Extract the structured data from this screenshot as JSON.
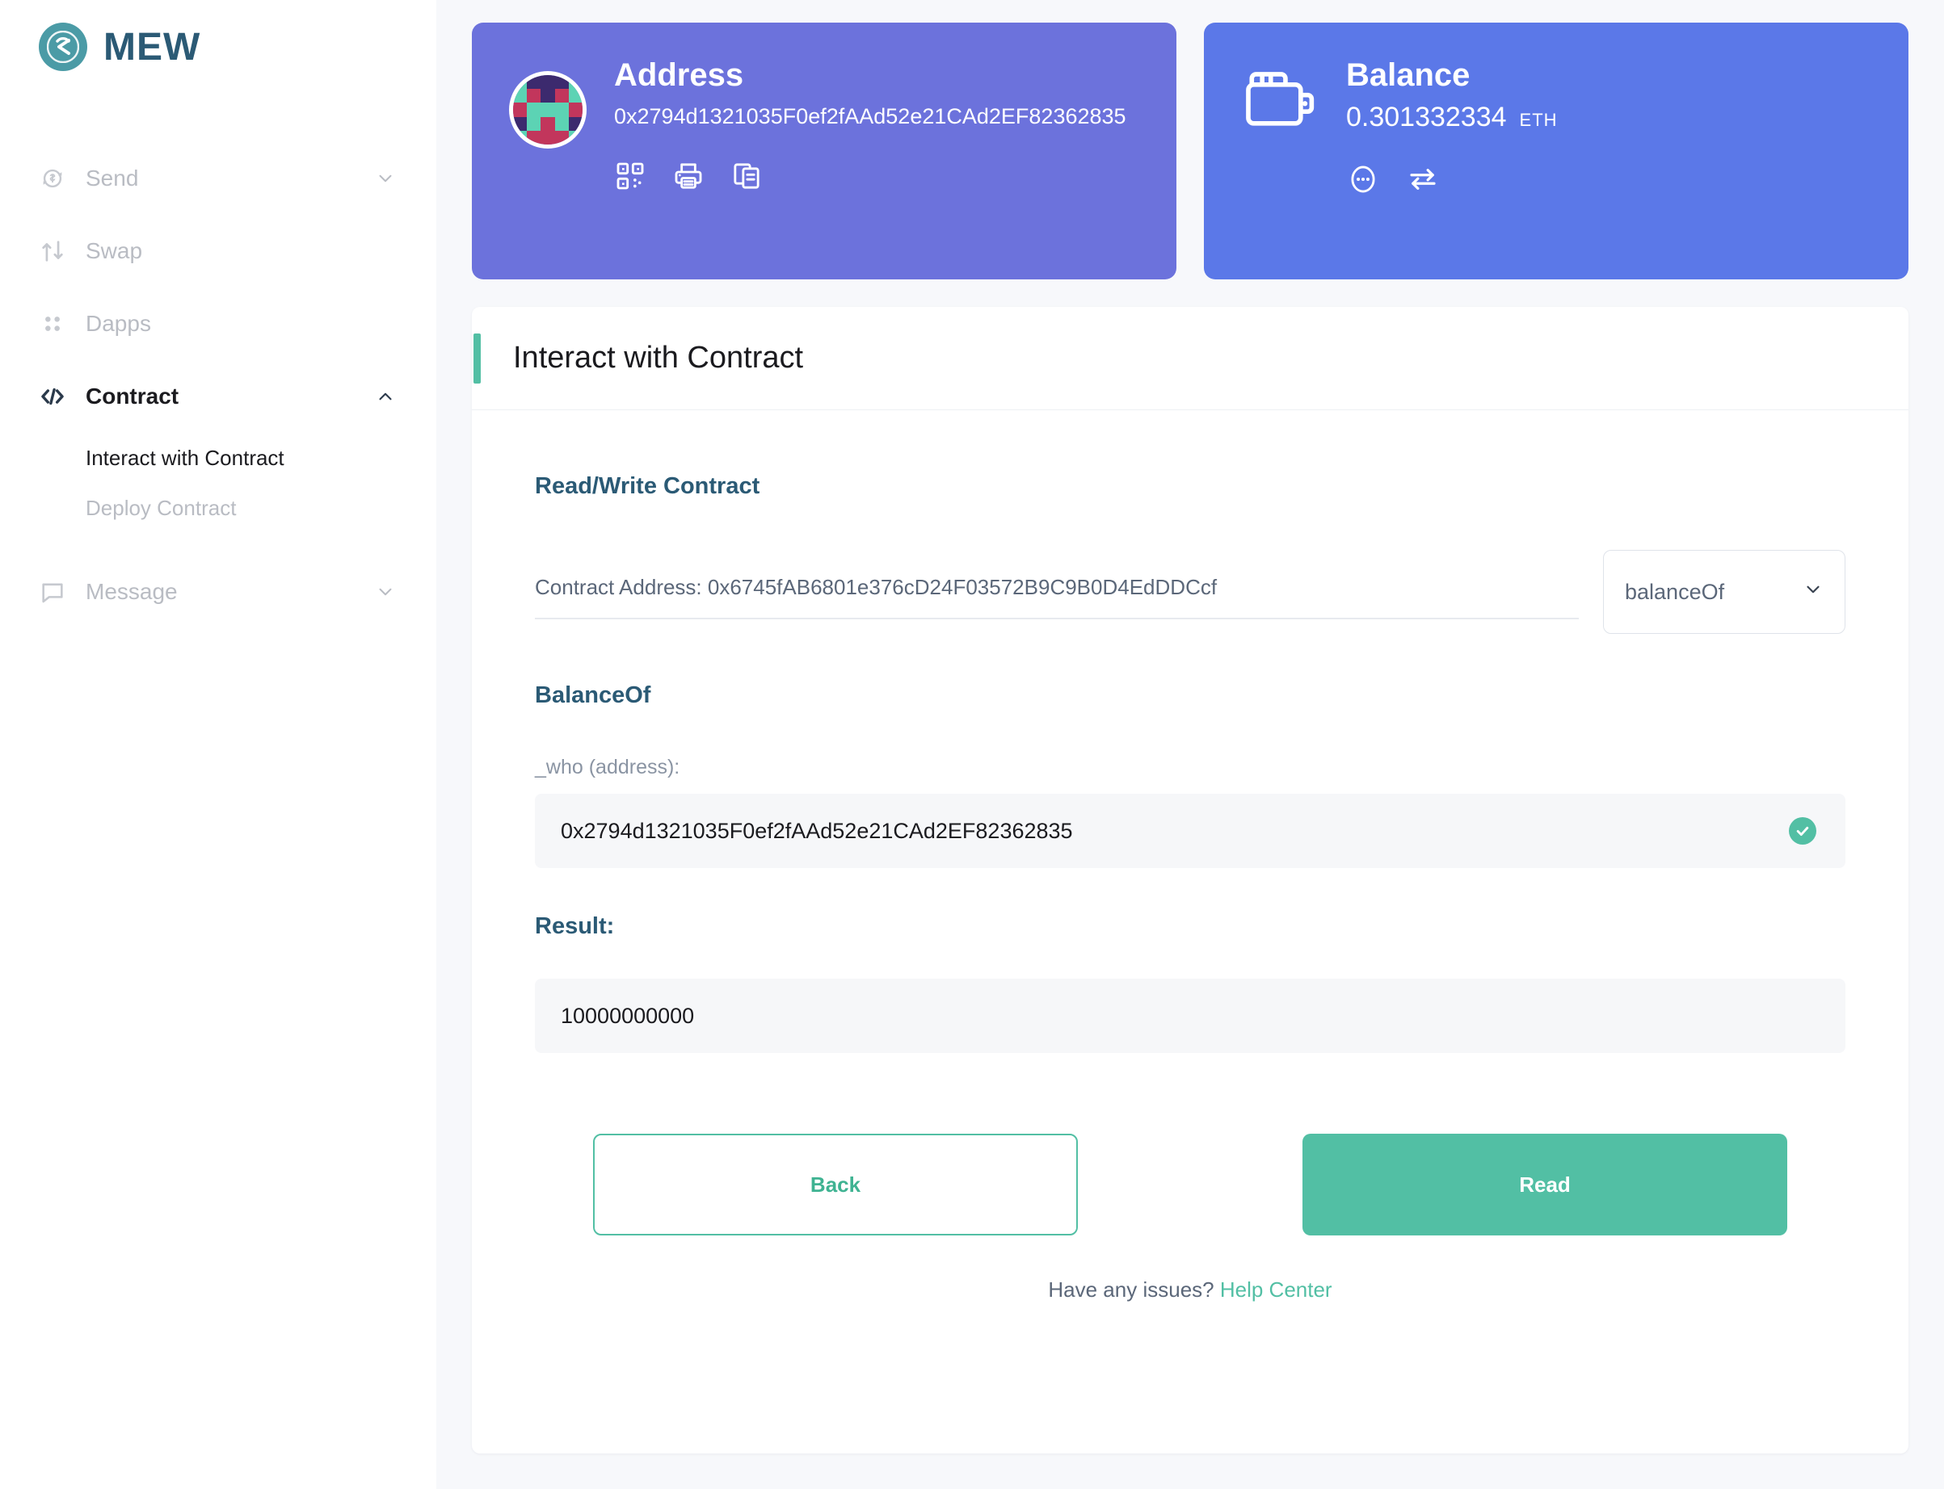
{
  "brand": {
    "name": "MEW",
    "logo_icon": "mew-logo-icon"
  },
  "sidebar": {
    "items": [
      {
        "label": "Send",
        "icon": "send-circle-icon",
        "chevron": "chevron-down-icon",
        "active": false
      },
      {
        "label": "Swap",
        "icon": "swap-arrows-icon",
        "chevron": "",
        "active": false
      },
      {
        "label": "Dapps",
        "icon": "dapps-dots-icon",
        "chevron": "",
        "active": false
      },
      {
        "label": "Contract",
        "icon": "code-brackets-icon",
        "chevron": "chevron-up-icon",
        "active": true
      },
      {
        "label": "Message",
        "icon": "message-bubble-icon",
        "chevron": "chevron-down-icon",
        "active": false
      }
    ],
    "contract_children": [
      {
        "label": "Interact with Contract",
        "active": true
      },
      {
        "label": "Deploy Contract",
        "active": false
      }
    ]
  },
  "address_card": {
    "title": "Address",
    "value": "0x2794d1321035F0ef2fAAd52e21CAd2EF82362835",
    "icons": [
      "qr-code-icon",
      "printer-icon",
      "copy-icon"
    ],
    "bg_color": "#6c72dc",
    "avatar": "identicon-avatar"
  },
  "balance_card": {
    "title": "Balance",
    "amount": "0.301332334",
    "unit": "ETH",
    "icons": [
      "more-ellipsis-icon",
      "swap-exchange-icon"
    ],
    "bg_color": "#5b78e8",
    "wallet_icon": "wallet-icon"
  },
  "panel": {
    "title": "Interact with Contract",
    "accent_color": "#52bfa4",
    "section_label": "Read/Write Contract",
    "contract_address_line": "Contract Address: 0x6745fAB6801e376cD24F03572B9C9B0D4EdDDCcf",
    "function_select": {
      "value": "balanceOf",
      "chevron": "chevron-down-icon"
    },
    "function_name": "BalanceOf",
    "input_label": "_who (address):",
    "input_value": "0x2794d1321035F0ef2fAAd52e21CAd2EF82362835",
    "input_valid_icon": "check-circle-icon",
    "result_label": "Result:",
    "result_value": "10000000000",
    "back_button": "Back",
    "read_button": "Read"
  },
  "footer": {
    "text": "Have any issues?",
    "link": "Help Center"
  }
}
